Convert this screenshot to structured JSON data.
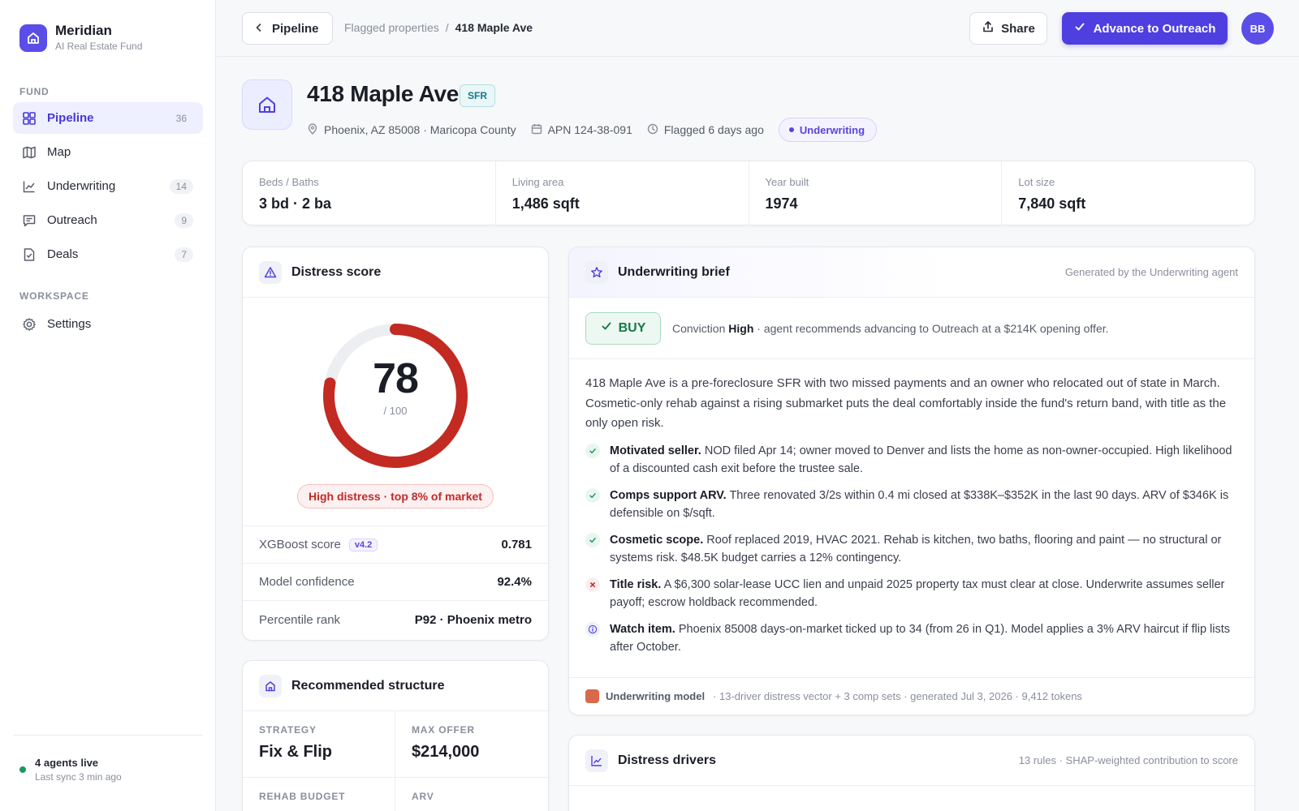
{
  "brand": {
    "name": "Meridian",
    "subtitle": "AI Real Estate Fund"
  },
  "sidebar": {
    "fund_label": "FUND",
    "workspace_label": "WORKSPACE",
    "items": [
      {
        "label": "Pipeline",
        "count": "36",
        "icon": "grid-icon",
        "active": true
      },
      {
        "label": "Map",
        "count": "",
        "icon": "map-icon"
      },
      {
        "label": "Underwriting",
        "count": "14",
        "icon": "chart-line-icon"
      },
      {
        "label": "Outreach",
        "count": "9",
        "icon": "message-icon"
      },
      {
        "label": "Deals",
        "count": "7",
        "icon": "document-check-icon"
      }
    ],
    "settings_label": "Settings",
    "footer": {
      "title": "4 agents live",
      "subtitle": "Last sync 3 min ago"
    }
  },
  "topbar": {
    "back_label": "Pipeline",
    "breadcrumb": {
      "parent": "Flagged properties",
      "separator": "/",
      "current": "418 Maple Ave"
    },
    "share_label": "Share",
    "advance_label": "Advance to Outreach",
    "avatar_initials": "BB"
  },
  "property": {
    "title": "418 Maple Ave",
    "type_badge": "SFR",
    "location": "Phoenix, AZ 85008 · Maricopa County",
    "apn": "APN 124-38-091",
    "flagged": "Flagged 6 days ago",
    "status": "Underwriting"
  },
  "stats": [
    {
      "label": "Beds / Baths",
      "value": "3 bd · 2 ba"
    },
    {
      "label": "Living area",
      "value": "1,486 sqft"
    },
    {
      "label": "Year built",
      "value": "1974"
    },
    {
      "label": "Lot size",
      "value": "7,840 sqft"
    }
  ],
  "distress": {
    "title": "Distress score",
    "score": "78",
    "score_max": "/ 100",
    "score_fraction": 0.78,
    "pill": "High distress · top 8% of market",
    "rows": [
      {
        "label": "XGBoost score",
        "badge": "v4.2",
        "value": "0.781"
      },
      {
        "label": "Model confidence",
        "value": "92.4%"
      },
      {
        "label": "Percentile rank",
        "value": "P92 · Phoenix metro"
      }
    ]
  },
  "structure": {
    "title": "Recommended structure",
    "cells": [
      {
        "label": "STRATEGY",
        "value": "Fix & Flip"
      },
      {
        "label": "MAX OFFER",
        "value": "$214,000"
      },
      {
        "label": "REHAB BUDGET",
        "value": ""
      },
      {
        "label": "ARV",
        "value": ""
      }
    ]
  },
  "brief": {
    "title": "Underwriting brief",
    "meta": "Generated by the Underwriting agent",
    "verdict": "BUY",
    "conviction_prefix": "Conviction ",
    "conviction_level": "High",
    "conviction_suffix": " · agent recommends advancing to Outreach at a $214K opening offer.",
    "paragraph": "418 Maple Ave is a pre-foreclosure SFR with two missed payments and an owner who relocated out of state in March. Cosmetic-only rehab against a rising submarket puts the deal comfortably inside the fund's return band, with title as the only open risk.",
    "bullets": [
      {
        "kind": "check",
        "head": "Motivated seller.",
        "text": " NOD filed Apr 14; owner moved to Denver and lists the home as non-owner-occupied. High likelihood of a discounted cash exit before the trustee sale."
      },
      {
        "kind": "check",
        "head": "Comps support ARV.",
        "text": " Three renovated 3/2s within 0.4 mi closed at $338K–$352K in the last 90 days. ARV of $346K is defensible on $/sqft."
      },
      {
        "kind": "check",
        "head": "Cosmetic scope.",
        "text": " Roof replaced 2019, HVAC 2021. Rehab is kitchen, two baths, flooring and paint — no structural or systems risk. $48.5K budget carries a 12% contingency."
      },
      {
        "kind": "risk",
        "head": "Title risk.",
        "text": " A $6,300 solar-lease UCC lien and unpaid 2025 property tax must clear at close. Underwrite assumes seller payoff; escrow holdback recommended."
      },
      {
        "kind": "info",
        "head": "Watch item.",
        "text": " Phoenix 85008 days-on-market ticked up to 34 (from 26 in Q1). Model applies a 3% ARV haircut if flip lists after October."
      }
    ],
    "footer_model": "Underwriting model",
    "footer_meta": "· 13-driver distress vector + 3 comp sets · generated Jul 3, 2026 · 9,412 tokens"
  },
  "drivers": {
    "title": "Distress drivers",
    "meta": "13 rules · SHAP-weighted contribution to score"
  },
  "colors": {
    "accent": "#4f3fe0",
    "danger": "#c22a22",
    "success": "#1a9a5a"
  }
}
